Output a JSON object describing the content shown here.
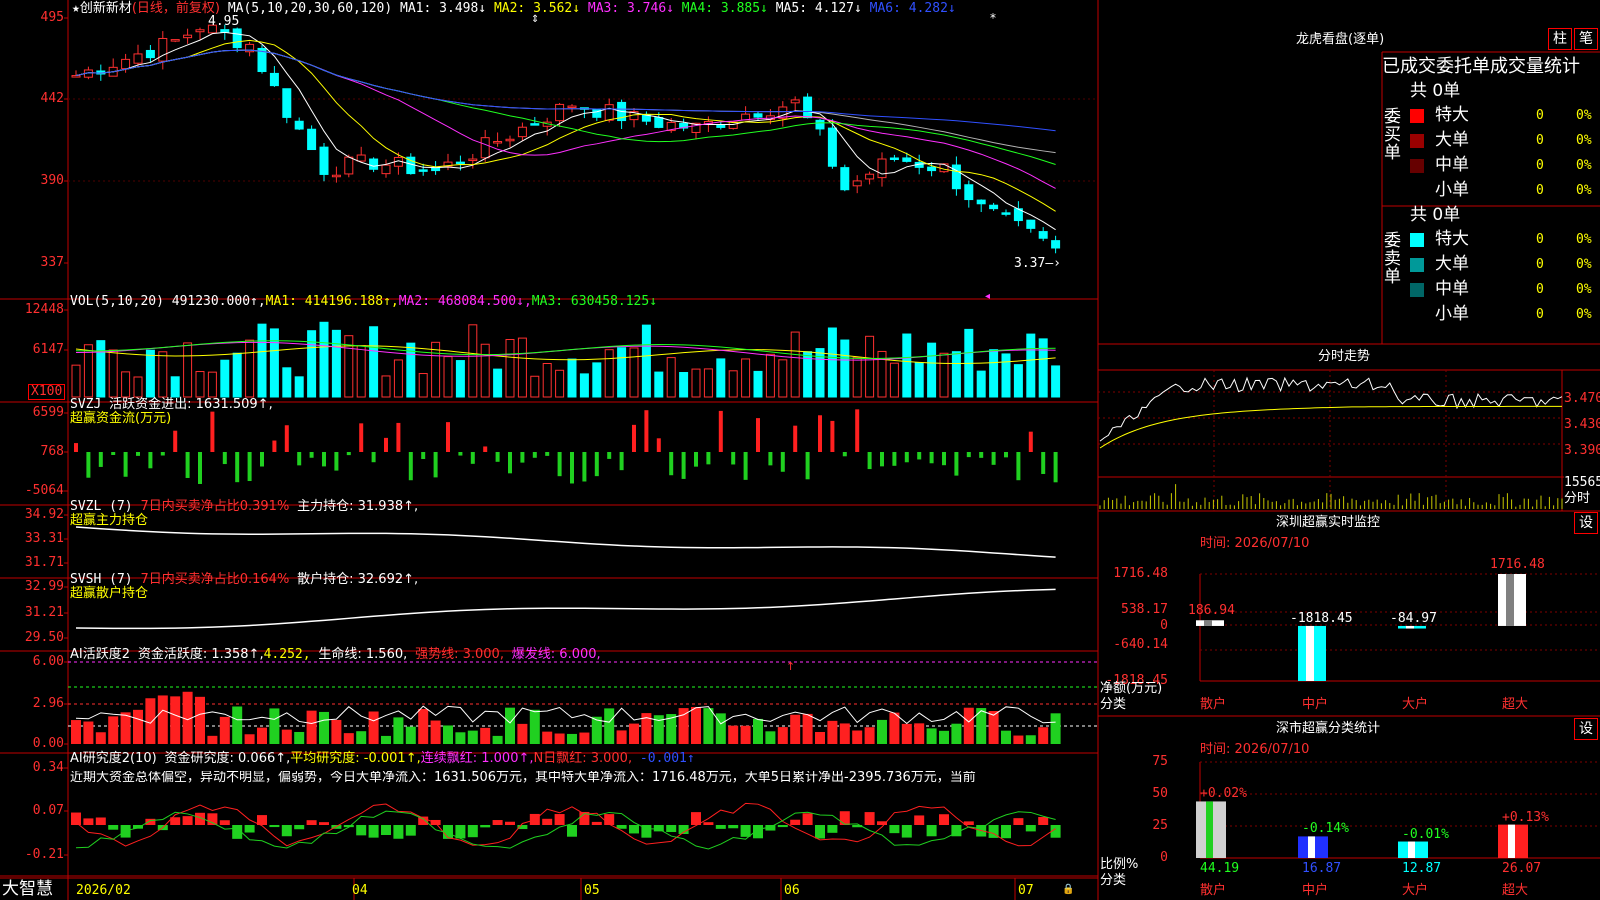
{
  "stock": {
    "star": "★",
    "name": "创新新材",
    "mode": "(日线，前复权)"
  },
  "ma_bar": {
    "label": "MA(5,10,20,30,60,120)",
    "items": [
      {
        "text": "MA1: 3.498↓",
        "color": "#ffffff"
      },
      {
        "text": "MA2: 3.562↓",
        "color": "#ffff00"
      },
      {
        "text": "MA3: 3.746↓",
        "color": "#ff30ff"
      },
      {
        "text": "MA4: 3.885↓",
        "color": "#20ff20"
      },
      {
        "text": "MA5: 4.127↓",
        "color": "#ffffff"
      },
      {
        "text": "MA6: 4.282↓",
        "color": "#3050ff"
      }
    ]
  },
  "price_axis": [
    "495",
    "442",
    "390",
    "337"
  ],
  "high_label": "4.95",
  "low_label": "3.37",
  "vol_panel": {
    "label": "VOL(5,10,20)",
    "vol": "491230.000↑,",
    "ma1": "MA1: 414196.188↑,",
    "ma2": "MA2: 468084.500↓,",
    "ma3": "MA3: 630458.125↓",
    "axis": [
      "12448",
      "6147",
      "X100"
    ]
  },
  "svzj": {
    "label": "SVZJ",
    "title": "活跃资金进出: 1631.509↑,",
    "sub": "超赢资金流(万元)",
    "axis": [
      "6599",
      "768",
      "-5064"
    ]
  },
  "svzl": {
    "label": "SVZL (7)",
    "net": "7日内买卖净占比0.391%",
    "hold": "主力持仓: 31.938↑,",
    "sub": "超赢主力持仓",
    "axis": [
      "34.92",
      "33.31",
      "31.71"
    ]
  },
  "svsh": {
    "label": "SVSH (7)",
    "net": "7日内买卖净占比0.164%",
    "hold": "散户持仓: 32.692↑,",
    "sub": "超赢散户持仓",
    "axis": [
      "32.99",
      "31.21",
      "29.50"
    ]
  },
  "ai_active": {
    "label": "AI活跃度2",
    "fund": "资金活跃度: 1.358↑,",
    "v2": "4.252,",
    "life": "生命线: 1.560,",
    "strong": "强势线: 3.000,",
    "burst": "爆发线: 6.000,",
    "axis": [
      "6.00",
      "2.96",
      "0.00"
    ]
  },
  "ai_research": {
    "label": "AI研究度2(10)",
    "fund": "资金研究度: 0.066↑,",
    "avg": "平均研究度: -0.001↑,",
    "red": "连续飘红: 1.000↑,",
    "nred": "N日飘红: 3.000,",
    "v5": "-0.001↑",
    "axis": [
      "0.34",
      "0.07",
      "-0.21"
    ],
    "comment": "近期大资金总体偏空，异动不明显，偏弱势，今日大单净流入：1631.506万元，其中特大单净流入：1716.48万元，大单5日累计净出-2395.736万元，当前"
  },
  "date_axis": [
    "2026/02",
    "04",
    "05",
    "06",
    "07"
  ],
  "brand": "大智慧",
  "right": {
    "dragon_title": "龙虎看盘(逐单)",
    "btn_column": "柱",
    "btn_pen": "笔",
    "stats_title": "已成交委托单成交量统计",
    "buy": {
      "total": "共 0单",
      "side": "委买单",
      "rows": [
        {
          "name": "特大",
          "count": "0",
          "pct": "0%",
          "color": "#ff0000"
        },
        {
          "name": "大单",
          "count": "0",
          "pct": "0%",
          "color": "#990000"
        },
        {
          "name": "中单",
          "count": "0",
          "pct": "0%",
          "color": "#660000"
        },
        {
          "name": "小单",
          "count": "0",
          "pct": "0%",
          "color": "#000000"
        }
      ]
    },
    "sell": {
      "total": "共 0单",
      "side": "委卖单",
      "rows": [
        {
          "name": "特大",
          "count": "0",
          "pct": "0%",
          "color": "#00ffff"
        },
        {
          "name": "大单",
          "count": "0",
          "pct": "0%",
          "color": "#009999"
        },
        {
          "name": "中单",
          "count": "0",
          "pct": "0%",
          "color": "#006666"
        },
        {
          "name": "小单",
          "count": "0",
          "pct": "0%",
          "color": "#000000"
        }
      ]
    },
    "intraday": {
      "title": "分时走势",
      "axis": [
        "3.470",
        "3.430",
        "3.390"
      ],
      "vol_top": "15565",
      "vol_label": "分时"
    },
    "monitor": {
      "title": "深圳超赢实时监控",
      "btn": "设",
      "time": "时间: 2026/07/10",
      "axis": [
        "1716.48",
        "538.17",
        "0",
        "-640.14",
        "-1818.45"
      ],
      "unit": "净额(万元)",
      "cat": "分类",
      "bars": [
        {
          "cat": "散户",
          "value": 186.94,
          "label": "186.94"
        },
        {
          "cat": "中户",
          "value": -1818.45,
          "label": "-1818.45"
        },
        {
          "cat": "大户",
          "value": -84.97,
          "label": "-84.97"
        },
        {
          "cat": "超大",
          "value": 1716.48,
          "label": "1716.48"
        }
      ]
    },
    "class": {
      "title": "深市超赢分类统计",
      "btn": "设",
      "time": "时间: 2026/07/10",
      "axis": [
        "75",
        "50",
        "25",
        "0"
      ],
      "unit": "比例%",
      "cat": "分类",
      "bars": [
        {
          "cat": "散户",
          "value": 44.19,
          "label": "44.19",
          "chg": "+0.02%"
        },
        {
          "cat": "中户",
          "value": 16.87,
          "label": "16.87",
          "chg": "-0.14%"
        },
        {
          "cat": "大户",
          "value": 12.87,
          "label": "12.87",
          "chg": "-0.01%"
        },
        {
          "cat": "超大",
          "value": 26.07,
          "label": "26.07",
          "chg": "+0.13%"
        }
      ]
    }
  }
}
